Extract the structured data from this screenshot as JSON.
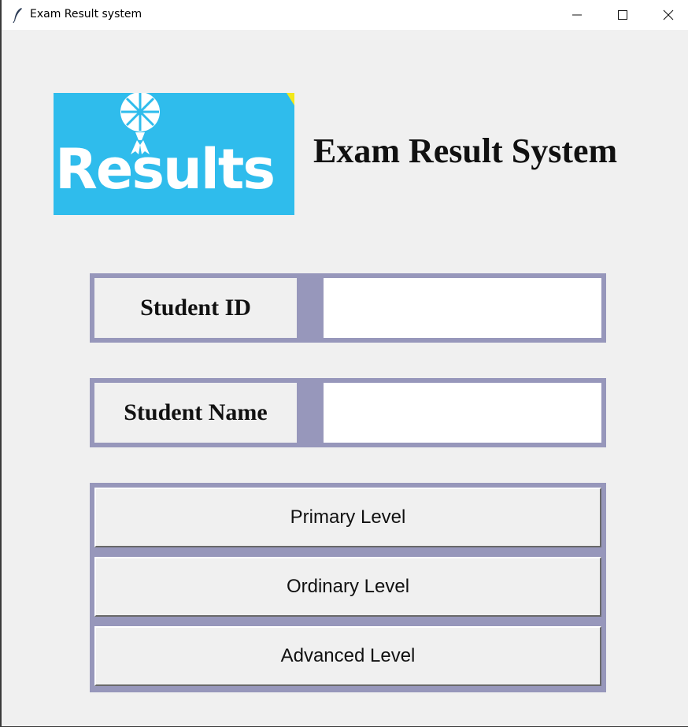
{
  "window": {
    "title": "Exam Result system",
    "icon": "feather-icon",
    "controls": [
      "minimize-icon",
      "maximize-icon",
      "close-icon"
    ]
  },
  "logo": {
    "text": "Results",
    "background": "#2fbcec"
  },
  "heading": "Exam Result System",
  "form": {
    "student_id": {
      "label": "Student ID",
      "value": ""
    },
    "student_name": {
      "label": "Student Name",
      "value": ""
    }
  },
  "levels": [
    {
      "label": "Primary Level"
    },
    {
      "label": "Ordinary Level"
    },
    {
      "label": "Advanced Level"
    }
  ],
  "colors": {
    "frame": "#9797bb",
    "background": "#f0f0f0",
    "input": "#ffffff"
  }
}
